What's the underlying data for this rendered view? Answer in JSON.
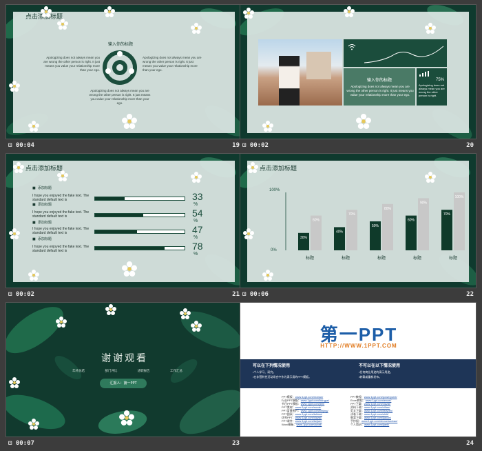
{
  "slides": [
    {
      "duration": "00:04",
      "number": "19",
      "title": "点击添加标题",
      "center_heading": "输入你的标题",
      "text_left": "Apologizing does not always mean you are wrong the other person is right. It just means you value your relationship more than your ego.",
      "text_right": "Apologizing does not always mean you are wrong the other person is right. It just means you value your relationship more than your ego.",
      "text_bottom": "Apologizing does not always mean you are wrong the other person is right. It just means you value your relationship more than your ego."
    },
    {
      "duration": "00:02",
      "number": "20",
      "box_heading": "输入你的标题",
      "box_text": "Apologizing does not always mean you are wrong the other person is right. It just means you value your relationship more than your ego.",
      "right_text": "Apologizing does not always mean you are wrong the other person is right.",
      "small_pct": "75%"
    },
    {
      "duration": "00:02",
      "number": "21",
      "title": "点击添加标题",
      "rows": [
        {
          "label": "添加标题",
          "desc": "I hope you enjoyed the fake text. The standard default text is",
          "value": 33,
          "pct": "33",
          "sign": "%"
        },
        {
          "label": "添加标题",
          "desc": "I hope you enjoyed the fake text. The standard default text is",
          "value": 54,
          "pct": "54",
          "sign": "%"
        },
        {
          "label": "添加标题",
          "desc": "I hope you enjoyed the fake text. The standard default text is",
          "value": 47,
          "pct": "47",
          "sign": "%"
        },
        {
          "label": "添加标题",
          "desc": "I hope you enjoyed the fake text. The standard default text is",
          "value": 78,
          "pct": "78",
          "sign": "%"
        }
      ]
    },
    {
      "duration": "00:06",
      "number": "22",
      "title": "点击添加标题",
      "ylabel_top": "100%",
      "ylabel_bottom": "0%"
    },
    {
      "duration": "00:07",
      "number": "23",
      "thanks": "谢谢观看",
      "subitems": [
        "年终总结",
        "部门评比",
        "述职报告",
        "工作汇总"
      ],
      "presenter": "汇报人：第一PPT"
    },
    {
      "duration": "",
      "number": "24",
      "logo": "第一PPT",
      "url": "HTTP://WWW.1PPT.COM",
      "can_title": "可以在下列情况使用",
      "can_items": [
        "•个人学习、研究。",
        "•在非营利性活动场合中作为演示用的PPT模板。"
      ],
      "cannot_title": "不可以在以下情况使用",
      "cannot_items": [
        "•任何商业用途的演示用途。",
        "•转载或重新发布。"
      ],
      "links_left": [
        "PPT模板：",
        "行业PPT模板：",
        "节日PPT模板：",
        "PPT素材：",
        "PPT背景图片：",
        "PPT图表：",
        "优秀PPT：",
        "PPT课件：",
        "Word模板："
      ],
      "links_left_urls": [
        "www.1ppt.com/moban/",
        "www.1ppt.com/hangye/",
        "www.1ppt.com/jieri/",
        "www.1ppt.com/sucai/",
        "www.1ppt.com/beijing/",
        "www.1ppt.com/tubiao/",
        "www.1ppt.com/xiazai/",
        "www.1ppt.com/kejian/",
        "www.1ppt.com/word/"
      ],
      "links_right": [
        "PPT教程：",
        "Excel教程：",
        "PPT下载：",
        "资料下载：",
        "范文下载：",
        "试卷下载：",
        "教案下载：",
        "手抄报：",
        "个人简历："
      ],
      "links_right_urls": [
        "www.1ppt.com/powerpoint/",
        "www.1ppt.com/excel/",
        "www.1ppt.com/xiazai/",
        "www.1ppt.com/ziliao/",
        "www.1ppt.com/fanwen/",
        "www.1ppt.com/shiti/",
        "www.1ppt.com/jiaoan/",
        "www.1ppt.com/shouchaobao/",
        "www.1ppt.com/jianli/"
      ]
    }
  ],
  "chart_data": {
    "type": "bar",
    "categories": [
      "标题",
      "标题",
      "标题",
      "标题",
      "标题"
    ],
    "series": [
      {
        "values": [
          30,
          40,
          50,
          60,
          70
        ]
      },
      {
        "values": [
          60,
          70,
          80,
          90,
          100
        ]
      }
    ],
    "ylim": [
      0,
      100
    ],
    "colors": [
      "#0f3a2a",
      "#c8c8c8"
    ]
  },
  "colors": {
    "bg": "#3c3c3c",
    "accent": "#1b4d3c",
    "panel": "#dde7e4",
    "blue": "#1e3557"
  }
}
